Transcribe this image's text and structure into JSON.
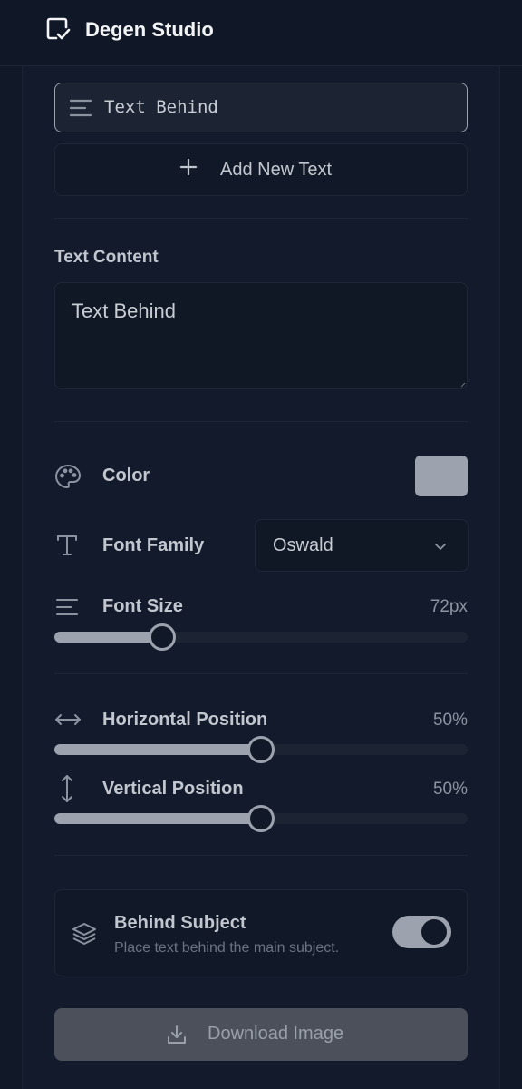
{
  "app": {
    "title": "Degen Studio"
  },
  "layers": [
    {
      "label": "Text Behind",
      "selected": true
    }
  ],
  "add_text": {
    "label": "Add New Text"
  },
  "text_content": {
    "label": "Text Content",
    "value": "Text Behind"
  },
  "color": {
    "label": "Color",
    "value": "#9ca3af"
  },
  "font_family": {
    "label": "Font Family",
    "value": "Oswald"
  },
  "font_size": {
    "label": "Font Size",
    "display": "72px",
    "fraction": 0.26
  },
  "horizontal_position": {
    "label": "Horizontal Position",
    "display": "50%",
    "value": 50
  },
  "vertical_position": {
    "label": "Vertical Position",
    "display": "50%",
    "value": 50
  },
  "behind_subject": {
    "title": "Behind Subject",
    "description": "Place text behind the main subject.",
    "enabled": true
  },
  "download": {
    "label": "Download Image"
  },
  "icons": {
    "logo": "app-logo-icon",
    "layer": "align-left-icon",
    "add": "plus-icon",
    "color": "palette-icon",
    "font_family": "type-icon",
    "font_size": "text-size-icon",
    "horizontal": "arrows-horizontal-icon",
    "vertical": "arrows-vertical-icon",
    "behind": "layers-icon",
    "download": "download-icon",
    "select": "chevron-down-icon"
  }
}
